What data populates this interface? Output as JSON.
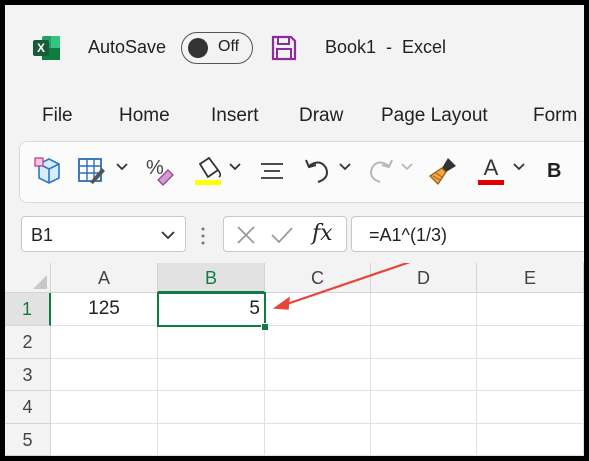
{
  "titlebar": {
    "app_icon": "excel-logo-icon",
    "autosave_label": "AutoSave",
    "autosave_state": "Off",
    "save_icon": "save-icon",
    "document_title": "Book1  -  Excel"
  },
  "tabs": [
    "File",
    "Home",
    "Insert",
    "Draw",
    "Page Layout",
    "Form"
  ],
  "toolbar": {
    "icons": [
      "cube-icon",
      "table-format-icon",
      "percent-style-icon",
      "fill-color-icon",
      "align-icon",
      "undo-icon",
      "redo-icon",
      "format-painter-icon",
      "font-color-icon",
      "bold-icon"
    ],
    "bold_label": "B",
    "fill_color": "#ffff00",
    "font_color": "#e00000"
  },
  "formula_bar": {
    "name_box": "B1",
    "formula": "=A1^(1/3)",
    "fx_label": "fx"
  },
  "grid": {
    "columns": [
      "A",
      "B",
      "C",
      "D",
      "E"
    ],
    "rows": [
      "1",
      "2",
      "3",
      "4",
      "5"
    ],
    "cells": {
      "A1": "125",
      "B1": "5"
    },
    "active_cell": "B1",
    "accent_color": "#107c41",
    "arrow_color": "#e8443a"
  }
}
